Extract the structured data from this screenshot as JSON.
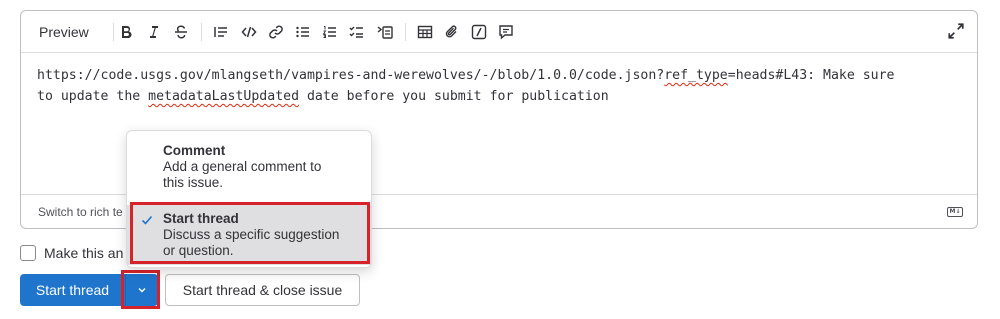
{
  "toolbar": {
    "preview_label": "Preview",
    "icons": [
      "bold-icon",
      "italic-icon",
      "strikethrough-icon",
      "quote-icon",
      "code-icon",
      "link-icon",
      "bulleted-list-icon",
      "numbered-list-icon",
      "task-list-icon",
      "collapsible-section-icon",
      "table-icon",
      "attach-file-icon",
      "slash-command-icon",
      "comment-template-icon",
      "fullscreen-icon"
    ]
  },
  "editor": {
    "text_line1_a": "https://code.usgs.gov/mlangseth/vampires-and-werewolves/-/blob/1.0.0/code.json?",
    "text_line1_spell": "ref_type",
    "text_line1_b": "=heads#L43: Make sure",
    "text_line2_a": "to update the ",
    "text_line2_spell": "metadataLastUpdated",
    "text_line2_b": " date before you submit for publication",
    "switch_label": "Switch to rich te",
    "markdown_badge": "M↓"
  },
  "confidential": {
    "label": "Make this an"
  },
  "actions": {
    "primary_label": "Start thread",
    "secondary_label": "Start thread & close issue"
  },
  "dropdown": {
    "items": [
      {
        "title": "Comment",
        "desc_line1": "Add a general comment to",
        "desc_line2": "this issue.",
        "selected": false
      },
      {
        "title": "Start thread",
        "desc_line1": "Discuss a specific suggestion",
        "desc_line2": "or question.",
        "selected": true
      }
    ]
  },
  "colors": {
    "primary": "#1f75cb",
    "highlight": "#d6232a",
    "selected_bg": "#dfdfe1"
  }
}
